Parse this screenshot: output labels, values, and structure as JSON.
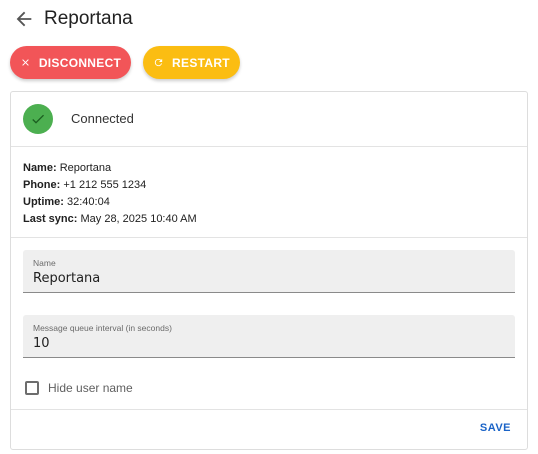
{
  "header": {
    "title": "Reportana",
    "back_icon": "arrow-left-icon"
  },
  "actions": {
    "disconnect_label": "DISCONNECT",
    "disconnect_icon": "close-icon",
    "disconnect_color": "#f25558",
    "restart_label": "RESTART",
    "restart_icon": "refresh-icon",
    "restart_color": "#fbbd12"
  },
  "status": {
    "icon": "check-icon",
    "text": "Connected",
    "color": "#4caf50"
  },
  "info": {
    "name_label": "Name:",
    "name_value": "Reportana",
    "phone_label": "Phone:",
    "phone_value": "+1 212 555 1234",
    "uptime_label": "Uptime:",
    "uptime_value": "32:40:04",
    "last_sync_label": "Last sync:",
    "last_sync_value": "May 28, 2025 10:40 AM"
  },
  "form": {
    "name_field": {
      "label": "Name",
      "value": "Reportana"
    },
    "interval_field": {
      "label": "Message queue interval (in seconds)",
      "value": "10"
    },
    "hide_user_name": {
      "label": "Hide user name",
      "checked": false
    },
    "save_label": "SAVE",
    "save_color": "#1a63c7"
  }
}
